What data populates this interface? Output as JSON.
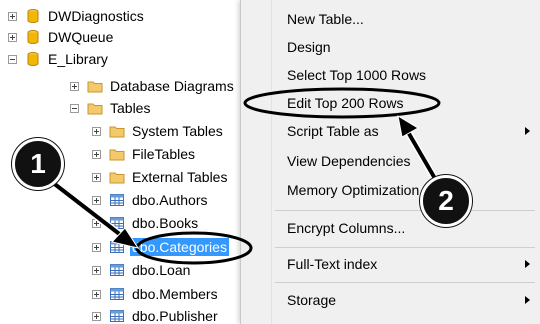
{
  "tree": {
    "items": [
      {
        "label": "DWDiagnostics",
        "icon": "database-icon",
        "expander": "plus"
      },
      {
        "label": "DWQueue",
        "icon": "database-icon",
        "expander": "plus"
      },
      {
        "label": "E_Library",
        "icon": "database-icon",
        "expander": "minus"
      },
      {
        "label": "Database Diagrams",
        "icon": "folder-icon",
        "expander": "plus"
      },
      {
        "label": "Tables",
        "icon": "folder-icon",
        "expander": "minus"
      },
      {
        "label": "System Tables",
        "icon": "folder-icon",
        "expander": "plus"
      },
      {
        "label": "FileTables",
        "icon": "folder-icon",
        "expander": "plus"
      },
      {
        "label": "External Tables",
        "icon": "folder-icon",
        "expander": "plus"
      },
      {
        "label": "dbo.Authors",
        "icon": "table-icon",
        "expander": "plus"
      },
      {
        "label": "dbo.Books",
        "icon": "table-icon",
        "expander": "plus"
      },
      {
        "label": "dbo.Categories",
        "icon": "table-icon",
        "expander": "plus",
        "selected": true
      },
      {
        "label": "dbo.Loan",
        "icon": "table-icon",
        "expander": "plus"
      },
      {
        "label": "dbo.Members",
        "icon": "table-icon",
        "expander": "plus"
      },
      {
        "label": "dbo.Publisher",
        "icon": "table-icon",
        "expander": "plus"
      }
    ]
  },
  "context_menu": {
    "items": [
      {
        "label": "New Table..."
      },
      {
        "label": "Design"
      },
      {
        "label": "Select Top 1000 Rows"
      },
      {
        "label": "Edit Top 200 Rows",
        "highlighted": true
      },
      {
        "label": "Script Table as",
        "submenu": true
      },
      {
        "label": "View Dependencies"
      },
      {
        "label": "Memory Optimization Advisor"
      },
      {
        "label": "Encrypt Columns..."
      },
      {
        "label": "Full-Text index",
        "submenu": true
      },
      {
        "label": "Storage",
        "submenu": true
      }
    ]
  },
  "annotations": {
    "callout_1": "1",
    "callout_2": "2",
    "accent_color": "#000000",
    "selection_color": "#3399ff"
  }
}
